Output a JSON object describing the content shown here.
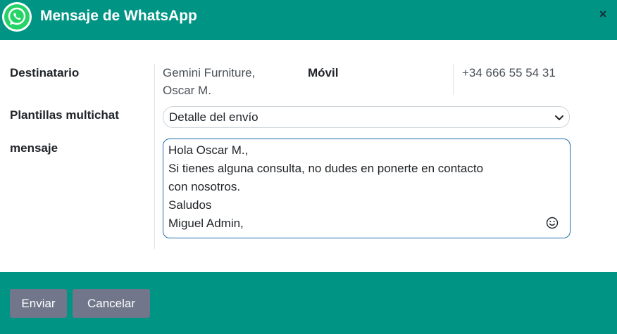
{
  "dialog": {
    "title": "Mensaje de WhatsApp",
    "close_label": "×"
  },
  "form": {
    "recipient_label": "Destinatario",
    "recipient_line1": "Gemini Furniture,",
    "recipient_line2": "Oscar M.",
    "mobile_label": "Móvil",
    "mobile_value": "+34 666 55 54 31",
    "templates_label": "Plantillas multichat",
    "template_selected": "Detalle del envío",
    "message_label": "mensaje",
    "message_lines": [
      "Hola Oscar M.,",
      "Si tienes alguna consulta, no dudes en ponerte en contacto",
      "con nosotros.",
      "Saludos",
      "Miguel Admin,"
    ]
  },
  "footer": {
    "send_label": "Enviar",
    "cancel_label": "Cancelar"
  },
  "icons": {
    "logo": "whatsapp-icon",
    "close": "close-icon",
    "dropdown": "chevron-down-icon",
    "emoji": "emoji-icon"
  },
  "colors": {
    "header_bg": "#009484",
    "footer_bg": "#009484",
    "button_bg": "#71768a",
    "focus_border": "#1f6ea8"
  }
}
